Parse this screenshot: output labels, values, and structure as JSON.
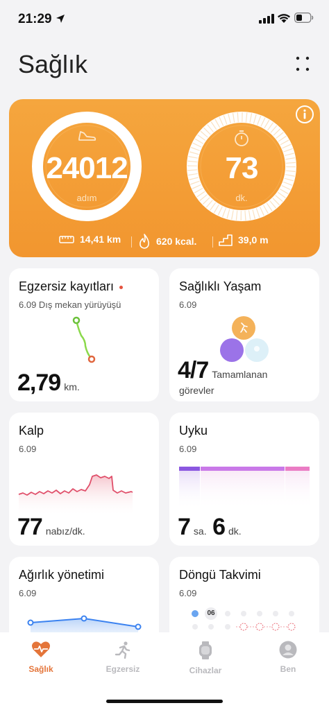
{
  "status_bar": {
    "time": "21:29"
  },
  "header": {
    "title": "Sağlık"
  },
  "hero": {
    "steps": {
      "value": "24012",
      "unit": "adım"
    },
    "minutes": {
      "value": "73",
      "unit": "dk."
    },
    "distance": "14,41 km",
    "calories": "620 kcal.",
    "floors": "39,0 m"
  },
  "cards": {
    "exercise": {
      "title": "Egzersiz kayıtları",
      "date_activity": "6.09 Dış mekan yürüyüşü",
      "value": "2,79",
      "unit": "km."
    },
    "healthy": {
      "title": "Sağlıklı Yaşam",
      "date": "6.09",
      "value": "4/7",
      "label_line1": "Tamamlanan",
      "label_line2": "görevler"
    },
    "heart": {
      "title": "Kalp",
      "date": "6.09",
      "value": "77",
      "unit": "nabız/dk."
    },
    "sleep": {
      "title": "Uyku",
      "date": "6.09",
      "hours": "7",
      "hours_unit": "sa.",
      "minutes": "6",
      "minutes_unit": "dk."
    },
    "weight": {
      "title": "Ağırlık yönetimi",
      "date": "6.09"
    },
    "cycle": {
      "title": "Döngü Takvimi",
      "date": "6.09",
      "day_badge": "06"
    }
  },
  "tabs": [
    {
      "label": "Sağlık",
      "active": true
    },
    {
      "label": "Egzersiz",
      "active": false
    },
    {
      "label": "Cihazlar",
      "active": false
    },
    {
      "label": "Ben",
      "active": false
    }
  ],
  "colors": {
    "accent": "#e4753a",
    "hero": "#f3a03a",
    "heart_line": "#e04f6a",
    "sleep": "#c979e8"
  }
}
